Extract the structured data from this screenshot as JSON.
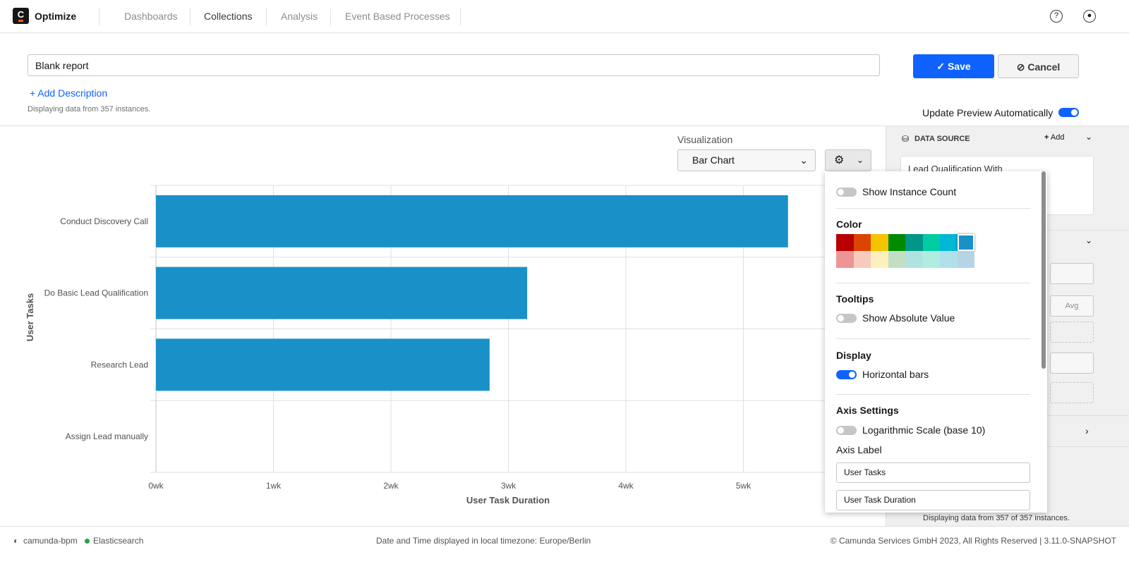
{
  "nav": {
    "logo": "C",
    "brand": "Optimize",
    "items": [
      {
        "label": "Dashboards",
        "active": false
      },
      {
        "label": "Collections",
        "active": true
      },
      {
        "label": "Analysis",
        "active": false
      },
      {
        "label": "Event Based Processes",
        "active": false
      }
    ],
    "help_icon": "question-circle-icon",
    "user_icon": "user-circle-icon"
  },
  "header": {
    "title_value": "Blank report",
    "add_description": "+ Add Description",
    "instances_text": "Displaying data from 357 instances.",
    "save": "Save",
    "cancel": "Cancel",
    "update_preview": "Update Preview Automatically",
    "update_preview_on": true
  },
  "visualization": {
    "label": "Visualization",
    "selected": "Bar Chart"
  },
  "settings_popover": {
    "show_instance_count": "Show Instance Count",
    "show_instance_count_on": false,
    "color_heading": "Color",
    "colors": [
      "#b80000",
      "#dc4405",
      "#f5c400",
      "#008a00",
      "#009689",
      "#00cca4",
      "#00b7d6",
      "#1991c8"
    ],
    "colors_light": [
      "#ed9594",
      "#f6cbbd",
      "#fdf0bf",
      "#c3dfc3",
      "#b0e3df",
      "#b0ede1",
      "#b0e1e8",
      "#b5d5e7"
    ],
    "selected_color": "#1991c8",
    "tooltips_heading": "Tooltips",
    "show_absolute_value": "Show Absolute Value",
    "show_absolute_value_on": false,
    "display_heading": "Display",
    "horizontal_bars": "Horizontal bars",
    "horizontal_bars_on": true,
    "axis_heading": "Axis Settings",
    "log_scale": "Logarithmic Scale (base 10)",
    "log_scale_on": false,
    "axis_label_heading": "Axis Label",
    "y_axis_label_value": "User Tasks",
    "x_axis_label_value": "User Task Duration"
  },
  "right_panel": {
    "data_source_title": "DATA SOURCE",
    "add": "Add",
    "process_name_partial": "Lead Qualification With",
    "avg": "Avg",
    "instances_text": "Displaying data from 357 of 357 instances."
  },
  "footer": {
    "engine": "camunda-bpm",
    "db": "Elasticsearch",
    "timezone": "Date and Time displayed in local timezone: Europe/Berlin",
    "copyright": "© Camunda Services GmbH 2023, All Rights Reserved | 3.11.0-SNAPSHOT"
  },
  "chart_data": {
    "type": "bar",
    "orientation": "horizontal",
    "categories": [
      "Conduct Discovery Call",
      "Do Basic Lead Qualification",
      "Research Lead",
      "Assign Lead manually"
    ],
    "values": [
      5.38,
      3.16,
      2.84,
      0
    ],
    "unit": "wk",
    "xticks": [
      "0wk",
      "1wk",
      "2wk",
      "3wk",
      "4wk",
      "5wk"
    ],
    "xlim": [
      0,
      6
    ],
    "xlabel": "User Task Duration",
    "ylabel": "User Tasks",
    "color": "#1991c8",
    "grid": true
  }
}
